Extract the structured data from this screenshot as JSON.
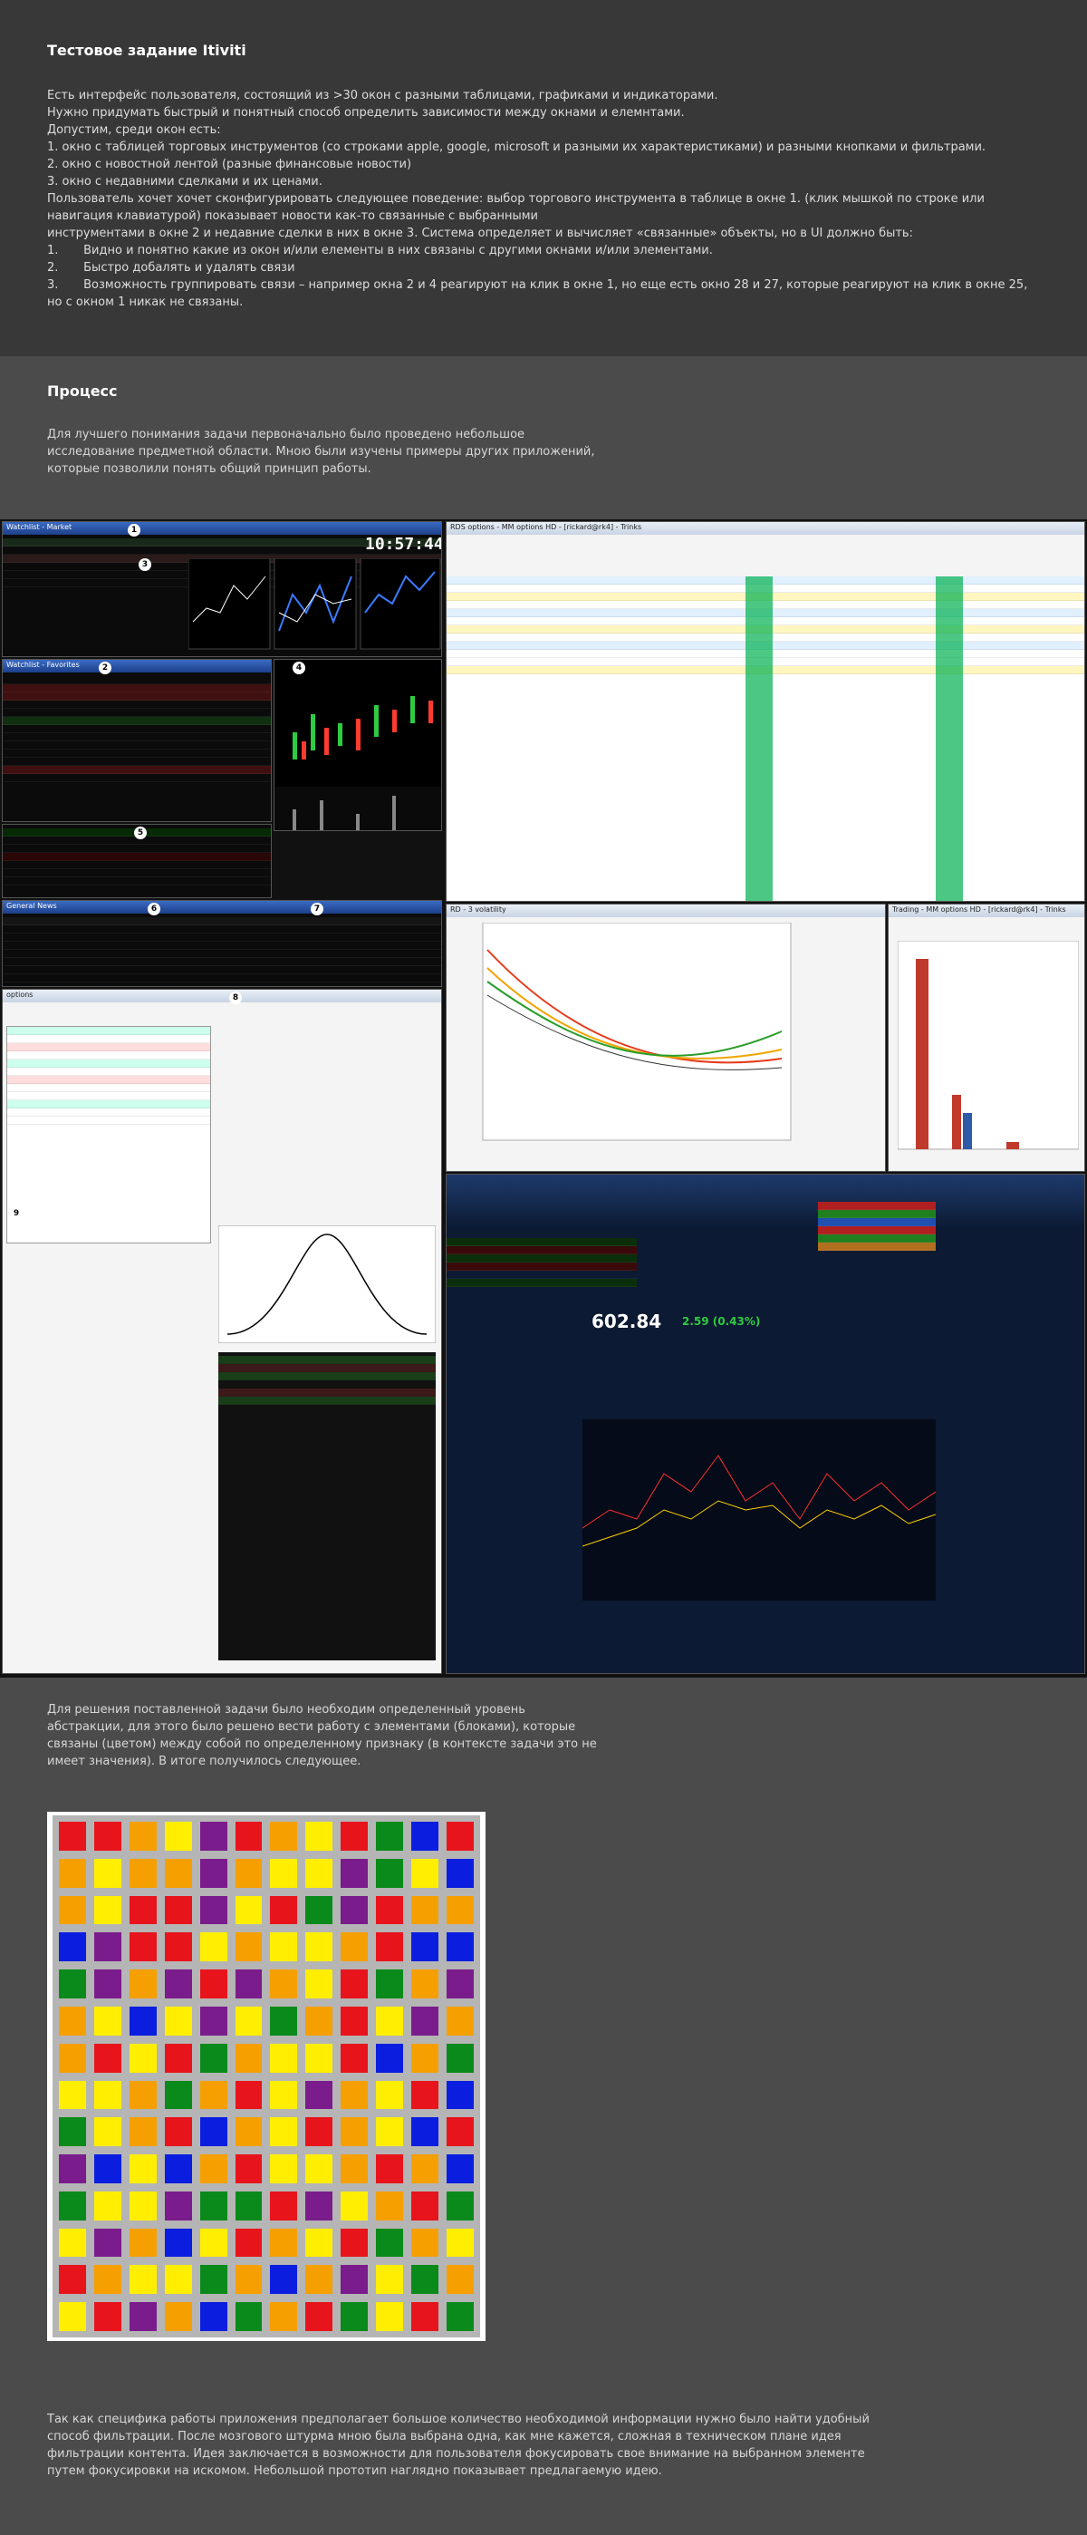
{
  "task": {
    "title": "Тестовое задание Itiviti",
    "lines": [
      "Есть интерфейс пользователя, состоящий из >30 окон с разными таблицами, графиками и индикаторами.",
      "Нужно придумать быстрый и понятный способ определить зависимости между окнами и елемнтами.",
      "Допустим, среди окон есть:",
      "1. окно с таблицей торговых инструментов (со строками apple, google, microsoft и разными их характеристиками) и разными кнопками и фильтрами.",
      "2. окно с новостной лентой (разные финансовые новости)",
      "3. окно с недавними сделками и их ценами.",
      "Пользователь хочет хочет сконфигурировать следующее поведение: выбор торгового инструмента в таблице в окне 1. (клик мышкой по  строке или навигация клавиатурой) показывает новости как-то связанные с выбранными",
      "инструментами в окне 2 и недавние сделки в них в окне 3. Система определяет и вычисляет «связанные» объекты, но в UI должно быть:"
    ],
    "numbered": [
      {
        "n": "1.",
        "text": "Видно и понятно какие из окон и/или елементы в них связаны с другими окнами и/или элементами."
      },
      {
        "n": "2.",
        "text": "Быстро добалять и удалять связи"
      },
      {
        "n": "3.",
        "text": "Возможность группировать связи – например окна 2 и 4 реагируют на клик в окне 1, но еще есть окно 28 и 27, которые реагируют на клик в окне 25, но с окном 1 никак не связаны."
      }
    ]
  },
  "process": {
    "title": "Процесс",
    "intro": [
      "Для лучшего понимания задачи первоначально было проведено небольшое",
      "исследование предметной области. Мною были изучены примеры других приложений,",
      "которые позволили понять общий принцип работы."
    ],
    "abstraction": [
      "Для решения поставленной задачи было необходим определенный уровень",
      "абстракции, для этого было решено вести работу с элементами (блоками), которые",
      "связаны (цветом) между собой по определенному признаку (в контексте задачи это не",
      "имеет значения). В итоге получилось следующее."
    ],
    "conclusion": [
      "Так как специфика работы приложения предполагает большое количество необходимой информации нужно было найти удобный",
      "способ фильтрации. После мозгового штурма мною была выбрана одна, как мне кажется, сложная в техническом плане идея",
      "фильтрации контента. Идея заключается в возможности для пользователя фокусировать свое внимание на выбранном элементе",
      "путем фокусировки на искомом. Небольшой прототип наглядно показывает предлагаемую идею."
    ]
  },
  "collage": {
    "clock": "10:57:44",
    "badges": [
      "1",
      "2",
      "3",
      "4",
      "5",
      "6",
      "7",
      "8",
      "9"
    ],
    "windows": {
      "market": "Watchlist - Market",
      "futures": "Watchlist - Favorites",
      "news": "General News",
      "rds": "RDS options - MM options HD - [rickard@rk4] - Trinks",
      "vola": "RD - 3 volatility",
      "trading": "Trading - MM options HD - [rickard@rk4] - Trinks",
      "options": "options"
    },
    "quote": "602.84",
    "quote_change": "2.59 (0.43%)"
  },
  "palette": {
    "red": "#e8141c",
    "orange": "#f5a000",
    "yellow": "#ffee00",
    "blue": "#0b1ee0",
    "purple": "#7a1c8c",
    "green": "#0a8a1a",
    "gray": "#b5b5b5"
  },
  "grid": [
    [
      "red",
      "red",
      "orange",
      "yellow",
      "purple",
      "red",
      "orange",
      "yellow",
      "red",
      "green",
      "blue",
      "red"
    ],
    [
      "orange",
      "yellow",
      "orange",
      "orange",
      "purple",
      "orange",
      "yellow",
      "yellow",
      "purple",
      "green",
      "yellow",
      "blue"
    ],
    [
      "orange",
      "yellow",
      "red",
      "red",
      "purple",
      "yellow",
      "red",
      "green",
      "purple",
      "red",
      "orange",
      "orange"
    ],
    [
      "blue",
      "purple",
      "red",
      "red",
      "yellow",
      "orange",
      "yellow",
      "yellow",
      "orange",
      "red",
      "blue",
      "blue"
    ],
    [
      "green",
      "purple",
      "orange",
      "purple",
      "red",
      "purple",
      "orange",
      "yellow",
      "red",
      "green",
      "orange",
      "purple"
    ],
    [
      "orange",
      "yellow",
      "blue",
      "yellow",
      "purple",
      "yellow",
      "green",
      "orange",
      "red",
      "yellow",
      "purple",
      "orange"
    ],
    [
      "orange",
      "red",
      "yellow",
      "red",
      "green",
      "orange",
      "yellow",
      "yellow",
      "red",
      "blue",
      "orange",
      "green"
    ],
    [
      "yellow",
      "yellow",
      "orange",
      "green",
      "orange",
      "red",
      "yellow",
      "purple",
      "orange",
      "yellow",
      "red",
      "blue"
    ],
    [
      "green",
      "yellow",
      "orange",
      "red",
      "blue",
      "orange",
      "yellow",
      "red",
      "orange",
      "yellow",
      "blue",
      "red"
    ],
    [
      "purple",
      "blue",
      "yellow",
      "blue",
      "orange",
      "red",
      "yellow",
      "yellow",
      "orange",
      "red",
      "orange",
      "blue"
    ],
    [
      "green",
      "yellow",
      "yellow",
      "purple",
      "green",
      "green",
      "red",
      "purple",
      "yellow",
      "orange",
      "red",
      "green"
    ],
    [
      "yellow",
      "purple",
      "orange",
      "blue",
      "yellow",
      "red",
      "orange",
      "yellow",
      "red",
      "green",
      "orange",
      "yellow"
    ],
    [
      "red",
      "orange",
      "yellow",
      "yellow",
      "green",
      "orange",
      "blue",
      "orange",
      "purple",
      "yellow",
      "green",
      "orange"
    ],
    [
      "yellow",
      "red",
      "purple",
      "orange",
      "blue",
      "green",
      "orange",
      "red",
      "green",
      "yellow",
      "red",
      "green"
    ]
  ]
}
